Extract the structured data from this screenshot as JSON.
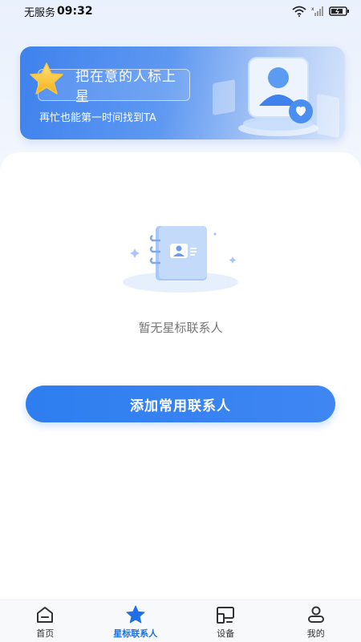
{
  "status_bar": {
    "carrier": "无服务",
    "time": "09:32",
    "icons": [
      "wifi-icon",
      "signal-icon",
      "battery-icon"
    ]
  },
  "banner": {
    "title": "把在意的人标上星",
    "subtitle": "再忙也能第一时间找到TA"
  },
  "empty_state": {
    "message": "暂无星标联系人",
    "icon": "contact-book-icon"
  },
  "add_button": {
    "label": "添加常用联系人"
  },
  "nav": {
    "items": [
      {
        "label": "首页",
        "icon": "home-icon",
        "active": false
      },
      {
        "label": "星标联系人",
        "icon": "star-icon",
        "active": true
      },
      {
        "label": "设备",
        "icon": "device-icon",
        "active": false
      },
      {
        "label": "我的",
        "icon": "profile-icon",
        "active": false
      }
    ]
  },
  "colors": {
    "accent": "#2e7ef0",
    "active_nav": "#1e6fe8"
  }
}
